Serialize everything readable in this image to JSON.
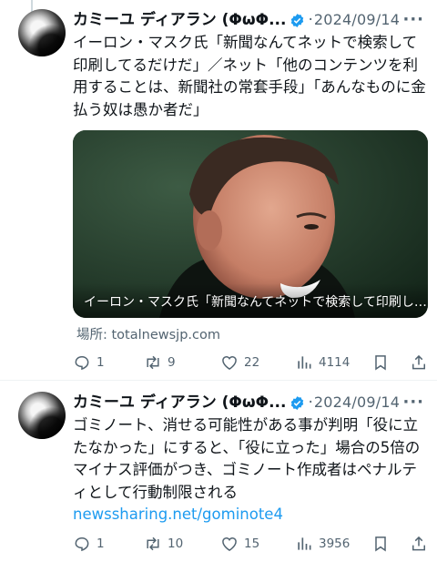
{
  "tweets": [
    {
      "author_name": "カミーユ ディアラン (ΦωΦ...",
      "verified_icon": "verified-badge-icon",
      "separator": "·",
      "date": "2024/09/14",
      "more_icon": "more-icon",
      "text": "イーロン・マスク氏「新聞なんてネットで検索して印刷してるだけだ」／ネット「他のコンテンツを利用することは、新聞社の常套手段」「あんなものに金払う奴は愚か者だ」",
      "media_caption": "イーロン・マスク氏「新聞なんてネットで検索して印刷し…",
      "source": "場所: totalnewsjp.com",
      "stats": {
        "replies": "1",
        "reposts": "9",
        "likes": "22",
        "views": "4114"
      }
    },
    {
      "author_name": "カミーユ ディアラン (ΦωΦ...",
      "verified_icon": "verified-badge-icon",
      "separator": "·",
      "date": "2024/09/14",
      "more_icon": "more-icon",
      "text": "ゴミノート、消せる可能性がある事が判明「役に立たなかった」にすると、「役に立った」場合の5倍のマイナス評価がつき、ゴミノート作成者はペナルティとして行動制限される",
      "link": "newssharing.net/gominote4",
      "stats": {
        "replies": "1",
        "reposts": "10",
        "likes": "15",
        "views": "3956"
      }
    }
  ],
  "colors": {
    "accent": "#1d9bf0",
    "secondary_text": "#536471",
    "primary_text": "#0f1419",
    "verified": "#1d9bf0"
  },
  "icons": [
    "reply-icon",
    "repost-icon",
    "like-icon",
    "views-icon",
    "bookmark-icon",
    "share-icon"
  ]
}
